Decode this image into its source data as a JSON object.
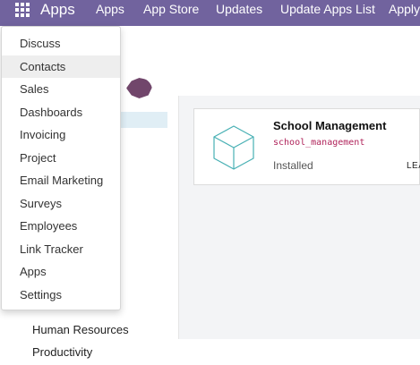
{
  "navbar": {
    "brand": "Apps",
    "menu": [
      "Apps",
      "App Store",
      "Updates",
      "Update Apps List",
      "Apply"
    ]
  },
  "dropdown": {
    "items": [
      "Discuss",
      "Contacts",
      "Sales",
      "Dashboards",
      "Invoicing",
      "Project",
      "Email Marketing",
      "Surveys",
      "Employees",
      "Link Tracker",
      "Apps",
      "Settings"
    ],
    "active": "Contacts"
  },
  "sidebar": {
    "categories": [
      "Human Resources",
      "Productivity"
    ]
  },
  "card": {
    "title": "School Management",
    "technical_name": "school_management",
    "status": "Installed",
    "action": "LEA"
  },
  "colors": {
    "navbar": "#71639e",
    "avatar": "#71466b",
    "tech_name": "#b0245b"
  }
}
